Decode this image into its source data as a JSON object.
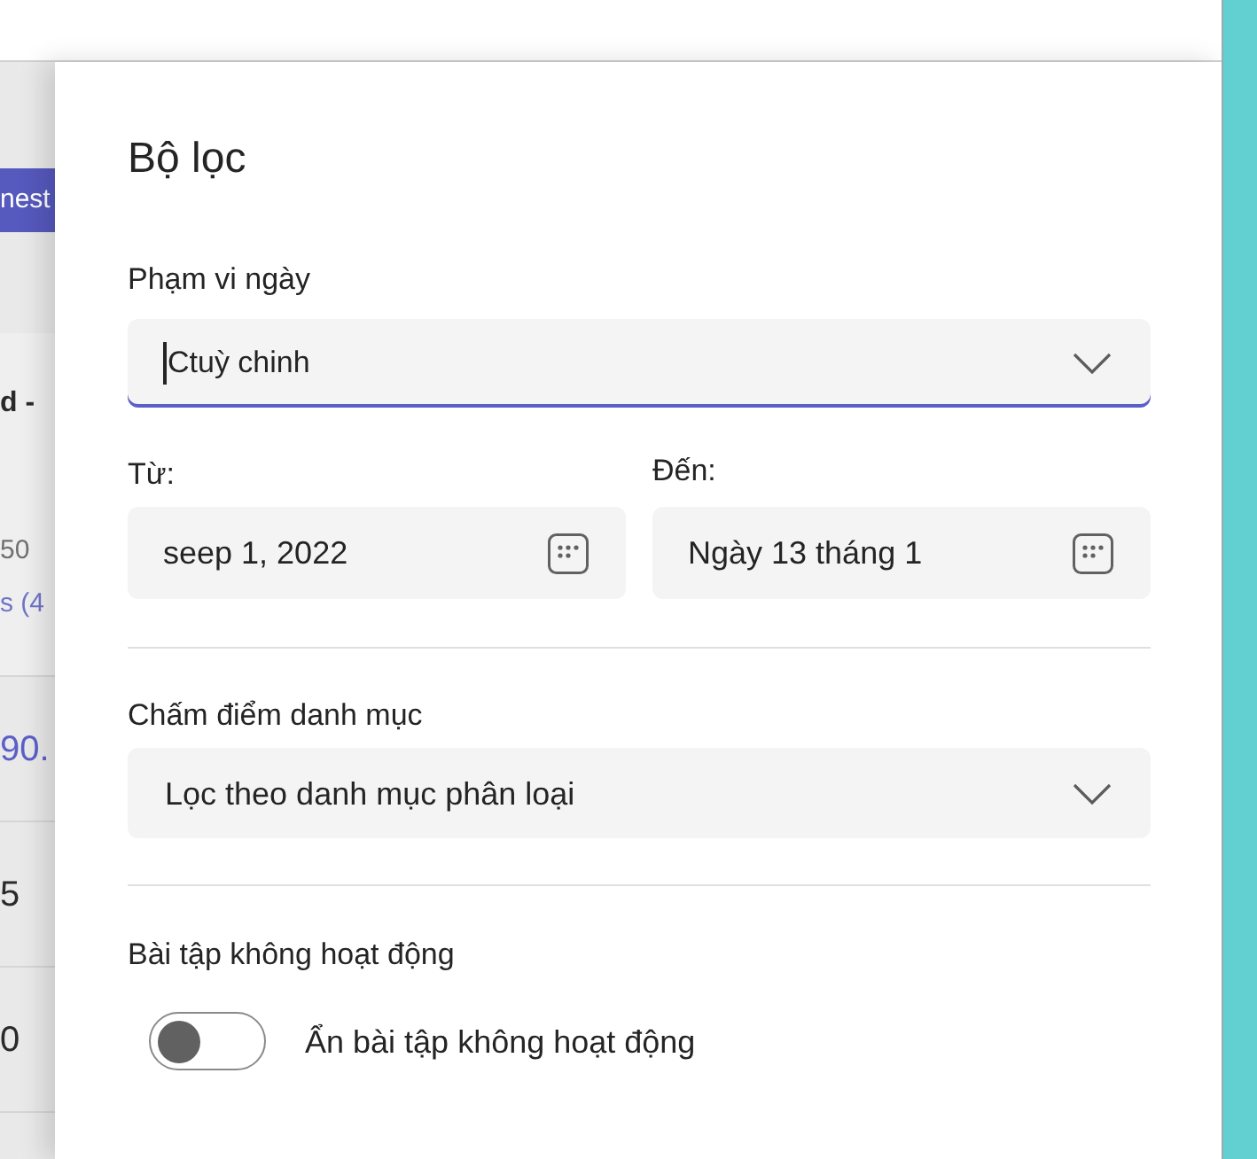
{
  "background_page": {
    "button_label": "nest",
    "card_title": "d -",
    "card_meta": "50",
    "card_link": "s (4",
    "rows": [
      {
        "text": "90.",
        "kind": "link"
      },
      {
        "text": "5",
        "kind": "plain"
      },
      {
        "text": "0",
        "kind": "plain"
      }
    ]
  },
  "filter_panel": {
    "title": "Bộ lọc",
    "date_range": {
      "label": "Phạm vi ngày",
      "value": "Ctuỳ chinh",
      "focused": true
    },
    "from": {
      "label": "Từ:",
      "value": "seep 1, 2022"
    },
    "to": {
      "label": "Đến:",
      "value": "Ngày 13 tháng 1"
    },
    "category": {
      "label": "Chấm điểm danh mục",
      "value": "Lọc theo danh mục phân loại",
      "focused": false
    },
    "inactive": {
      "label": "Bài tập không hoạt động",
      "toggle_label": "Ẩn bài tập không hoạt động",
      "on": false
    }
  }
}
